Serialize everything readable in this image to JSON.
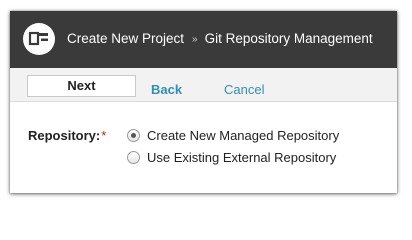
{
  "header": {
    "breadcrumb": [
      "Create New Project",
      "Git Repository Management"
    ],
    "separator": "»",
    "background_color": "#3a3a3a",
    "logo_icon": "app-logo-icon"
  },
  "toolbar": {
    "next_label": "Next",
    "back_label": "Back",
    "cancel_label": "Cancel",
    "link_color": "#2f8fb8"
  },
  "form": {
    "repository_label": "Repository:",
    "required_marker": "*",
    "options": [
      {
        "label": "Create New Managed Repository",
        "selected": true
      },
      {
        "label": "Use Existing External Repository",
        "selected": false
      }
    ]
  }
}
